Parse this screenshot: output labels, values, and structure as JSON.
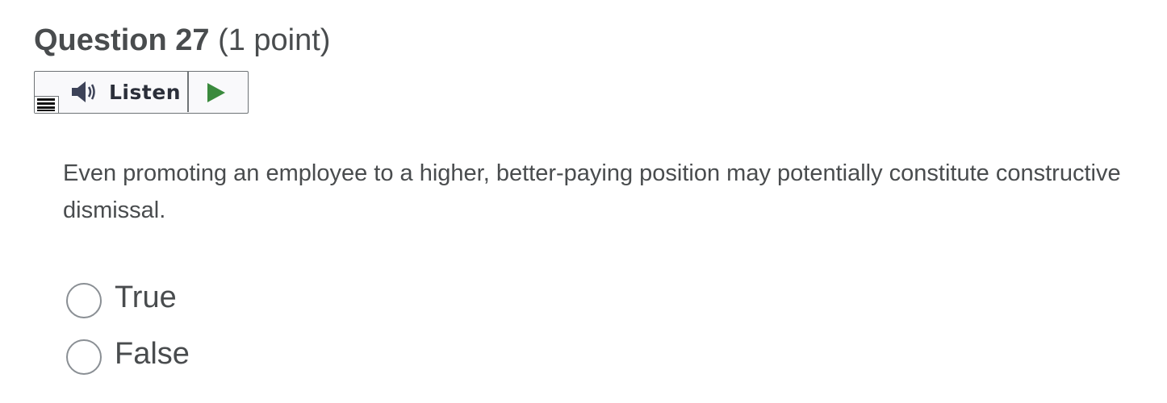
{
  "question": {
    "title": "Question 27",
    "points": "(1 point)",
    "text": "Even promoting an employee to a higher, better-paying position may potentially constitute constructive dismissal."
  },
  "listen_toolbar": {
    "label": "Listen",
    "icons": [
      "menu-icon",
      "speaker-icon",
      "play-icon"
    ],
    "play_color": "#3a8a3d"
  },
  "options": [
    {
      "label": "True",
      "selected": false
    },
    {
      "label": "False",
      "selected": false
    }
  ]
}
